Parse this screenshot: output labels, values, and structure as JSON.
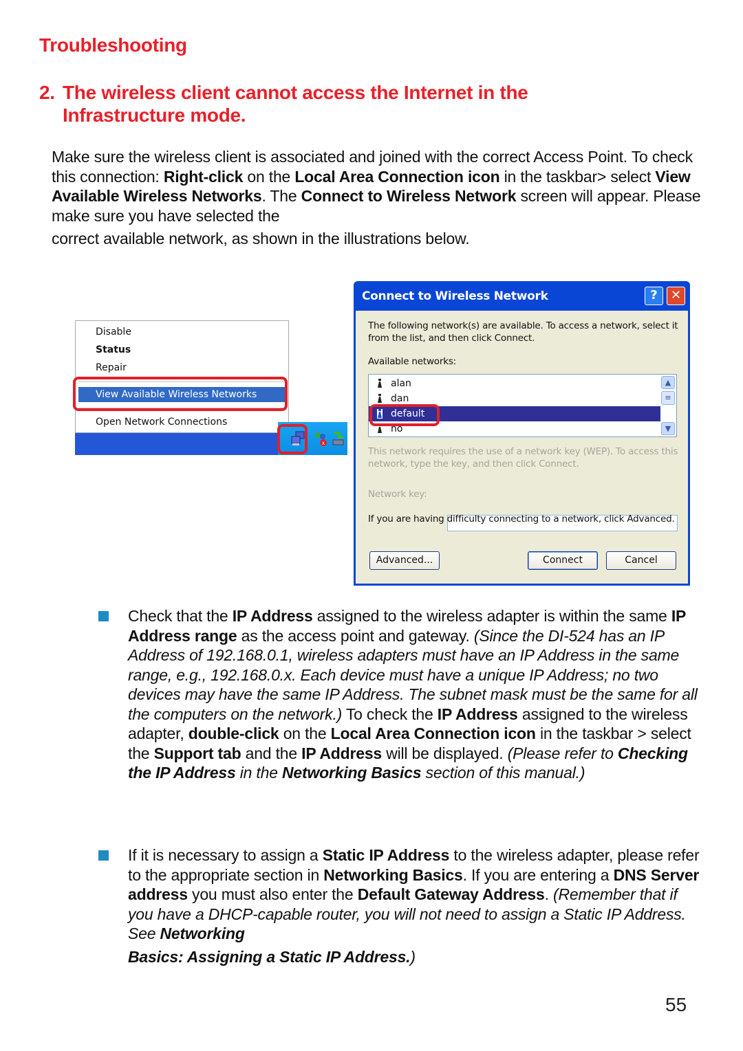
{
  "page": {
    "section_title": "Troubleshooting",
    "heading_number": "2.",
    "heading_line1": "The wireless client cannot access the Internet in the",
    "heading_line2": "Infrastructure mode.",
    "page_number": "55"
  },
  "intro": {
    "t1": "Make sure the wireless client is associated and joined with the correct Access Point. To check this connection: ",
    "b1": "Right-click",
    "t2": " on the ",
    "b2": "Local Area Connection icon",
    "t3": " in the taskbar> select ",
    "b3": "View Available Wireless Networks",
    "t4": ". The ",
    "b4": "Connect to Wireless Network",
    "t5": " screen will appear. Please make sure you have selected the",
    "t6": "correct available network, as shown in the illustrations below."
  },
  "context_menu": {
    "items": [
      "Disable",
      "Status",
      "Repair",
      "View Available Wireless Networks",
      "Open Network Connections"
    ],
    "selected": "View Available Wireless Networks",
    "highlight_color": "#e0202a",
    "selection_color": "#316ac5",
    "taskbar_color": "#2456d8"
  },
  "tray_icons": [
    "network-connection-icon",
    "messenger-icon",
    "safely-remove-hardware-icon"
  ],
  "dialog": {
    "title": "Connect to Wireless Network",
    "help_label": "?",
    "close_label": "✕",
    "description": "The following network(s) are available. To access a network, select it from the list, and then click Connect.",
    "available_label": "Available networks:",
    "networks": [
      "alan",
      "dan",
      "default",
      "no"
    ],
    "selected_network": "default",
    "wep_note": "This network requires the use of a network key (WEP). To access this network, type the key, and then click Connect.",
    "network_key_label": "Network key:",
    "network_key_value": "",
    "advanced_note": "If you are having difficulty connecting to a network, click Advanced.",
    "buttons": {
      "advanced": "Advanced...",
      "connect": "Connect",
      "cancel": "Cancel"
    },
    "titlebar_color": "#0a46d6",
    "body_color": "#ecebd8"
  },
  "bullet1": {
    "t1": "Check that the ",
    "b1": "IP Address",
    "t2": " assigned to the wireless adapter is within the same ",
    "b2": "IP Address range",
    "t3": " as the access point and gateway. ",
    "i1": "(Since the DI-524 has an IP Address of 192.168.0.1, wireless adapters must have an IP Address in the same range, e.g., 192.168.0.x. Each device must have a unique IP Address; no two devices may have the same IP Address. The subnet mask must be the same for all the computers on the network.)",
    "t4": " To check the ",
    "b3": "IP Address",
    "t5": " assigned to the wireless adapter, ",
    "b4": "double-click",
    "t6": " on the ",
    "b5": "Local Area Connection icon",
    "t7": " in the taskbar > select the ",
    "b6": "Support tab",
    "t8": " and the ",
    "b7": "IP Address",
    "t9": " will be displayed. ",
    "i2": "(Please refer to ",
    "ib1": "Checking the IP Address",
    "i3": " in the ",
    "ib2": "Networking Basics",
    "i4": " section of this manual.)"
  },
  "bullet2": {
    "t1": "If it is necessary to assign a ",
    "b1": "Static IP Address",
    "t2": " to the wireless adapter, please refer to the appropriate section in ",
    "b2": "Networking Basics",
    "t3": ". If you are entering a ",
    "b3": "DNS Server address",
    "t4": " you must also enter the ",
    "b4": "Default Gateway Address",
    "t5": ". ",
    "i1": "(Remember that if you have a DHCP-capable router, you will not need to assign a Static IP Address. See ",
    "ib1": "Networking",
    "ib2": "Basics: Assigning a Static IP Address.",
    "i2": ")"
  },
  "colors": {
    "heading": "#e8202a",
    "bullet": "#1e8bc3"
  }
}
